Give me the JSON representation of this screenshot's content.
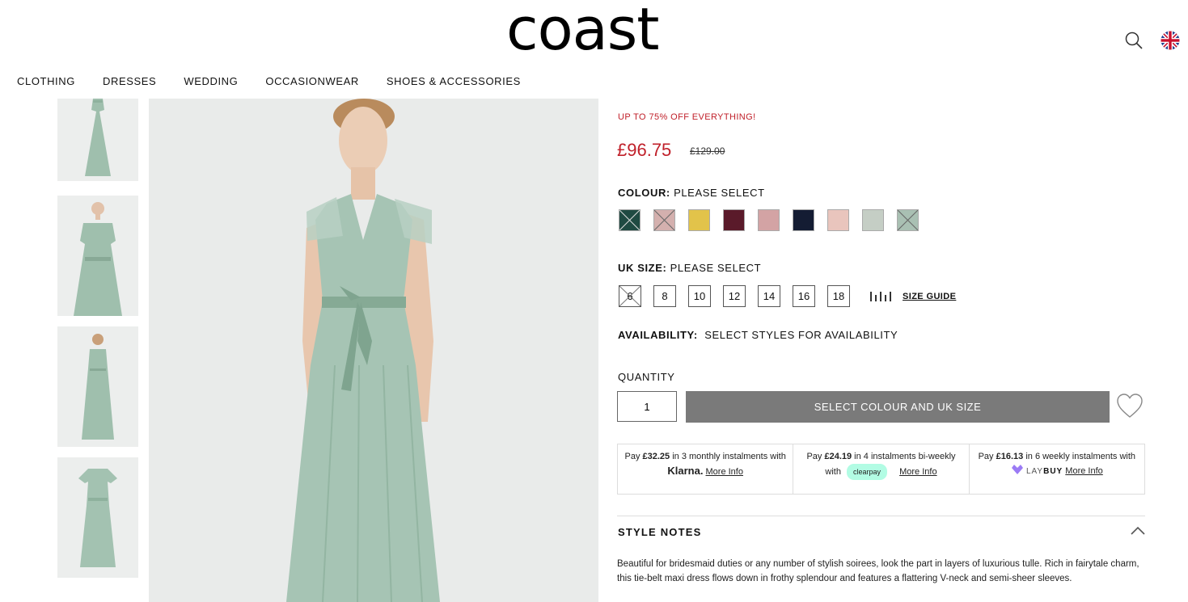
{
  "brand": {
    "logo_text": "coast"
  },
  "header": {
    "search_icon": "search-icon",
    "region_icon": "uk-flag-icon"
  },
  "nav": {
    "items": [
      "CLOTHING",
      "DRESSES",
      "WEDDING",
      "OCCASIONWEAR",
      "SHOES & ACCESSORIES"
    ]
  },
  "gallery": {
    "thumbnails": [
      "dress-front-full",
      "dress-front-upper",
      "dress-back-full",
      "dress-flat-lay"
    ],
    "main_image": "model-in-sage-tulle-maxi-dress"
  },
  "product": {
    "promo": "UP TO 75% OFF EVERYTHING!",
    "price": "£96.75",
    "old_price": "£129.00",
    "colour_label": "COLOUR:",
    "colour_value": "PLEASE SELECT",
    "colours": [
      {
        "hex": "#1f4a42",
        "unavailable": true
      },
      {
        "hex": "#d4b0ae",
        "unavailable": true
      },
      {
        "hex": "#e2c34a",
        "unavailable": false
      },
      {
        "hex": "#5a1a2a",
        "unavailable": false
      },
      {
        "hex": "#d3a3a4",
        "unavailable": false
      },
      {
        "hex": "#141c33",
        "unavailable": false
      },
      {
        "hex": "#e9c5bd",
        "unavailable": false
      },
      {
        "hex": "#c5cec5",
        "unavailable": false
      },
      {
        "hex": "#a9c0b3",
        "unavailable": true
      }
    ],
    "size_label": "UK SIZE:",
    "size_value": "PLEASE SELECT",
    "sizes": [
      {
        "label": "6",
        "unavailable": true
      },
      {
        "label": "8",
        "unavailable": false
      },
      {
        "label": "10",
        "unavailable": false
      },
      {
        "label": "12",
        "unavailable": false
      },
      {
        "label": "14",
        "unavailable": false
      },
      {
        "label": "16",
        "unavailable": false
      },
      {
        "label": "18",
        "unavailable": false
      }
    ],
    "size_guide": "SIZE GUIDE",
    "availability_label": "AVAILABILITY:",
    "availability_value": "SELECT STYLES FOR AVAILABILITY",
    "quantity_label": "QUANTITY",
    "quantity_value": "1",
    "add_button": "SELECT COLOUR AND UK SIZE"
  },
  "bnpl": {
    "klarna": {
      "pre": "Pay ",
      "amount": "£32.25",
      "post": " in 3 monthly instalments with ",
      "brand": "Klarna.",
      "more": "More Info"
    },
    "clearpay": {
      "pre": "Pay ",
      "amount": "£24.19",
      "post": " in 4 instalments bi-weekly with ",
      "brand": "clearpay",
      "more": "More Info"
    },
    "laybuy": {
      "pre": "Pay ",
      "amount": "£16.13",
      "post": " in 6 weekly instalments with ",
      "brand_light": "LAY",
      "brand_bold": "BUY",
      "more": "More Info"
    }
  },
  "style_notes": {
    "title": "STYLE NOTES",
    "text": "Beautiful for bridesmaid duties or any number of stylish soirees, look the part in layers of luxurious tulle. Rich in fairytale charm, this tie-belt maxi dress flows down in frothy splendour and features a flattering V-neck and semi-sheer sleeves."
  }
}
